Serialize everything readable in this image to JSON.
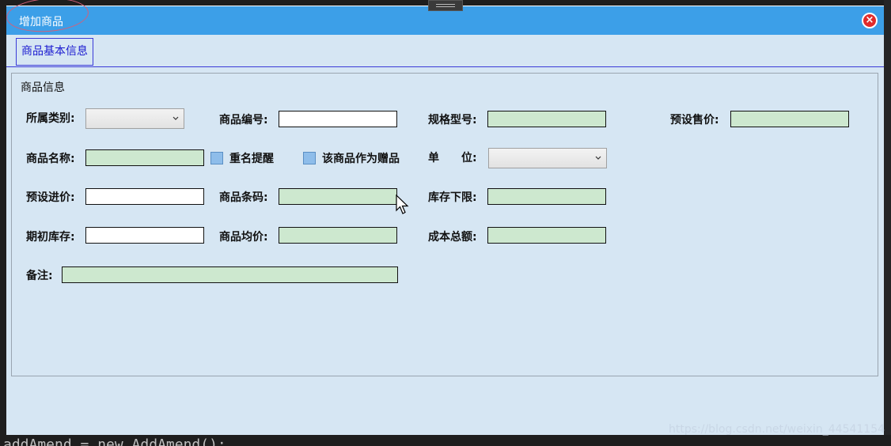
{
  "window": {
    "title": "增加商品",
    "close_icon": "close-icon"
  },
  "tabs": [
    {
      "label": "商品基本信息"
    }
  ],
  "group": {
    "title": "商品信息"
  },
  "form": {
    "category_label": "所属类别:",
    "product_no_label": "商品编号:",
    "spec_label": "规格型号:",
    "preset_price_label": "预设售价:",
    "product_name_label": "商品名称:",
    "dup_name_alert": "重名提醒",
    "as_gift": "该商品作为赠品",
    "unit_label": "单　　位:",
    "preset_cost_label": "预设进价:",
    "barcode_label": "商品条码:",
    "stock_min_label": "库存下限:",
    "opening_stock_label": "期初库存:",
    "avg_price_label": "商品均价:",
    "total_cost_label": "成本总额:",
    "remarks_label": "备注:"
  },
  "background": {
    "code_line": "addAmend = new AddAmend();",
    "watermark": "https://blog.csdn.net/weixin_44541154"
  }
}
